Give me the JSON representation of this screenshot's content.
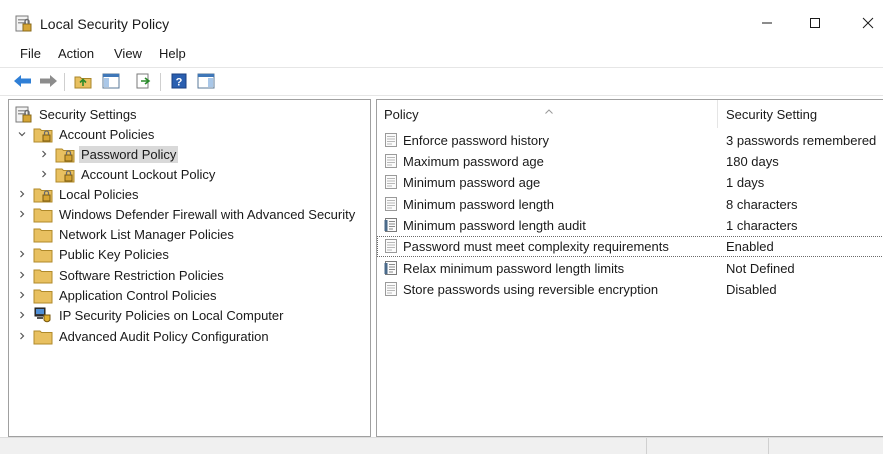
{
  "window": {
    "title": "Local Security Policy",
    "icon": "security-policy-icon",
    "controls": [
      "minimize-icon",
      "maximize-icon",
      "close-icon"
    ]
  },
  "menu": {
    "items": [
      "File",
      "Action",
      "View",
      "Help"
    ]
  },
  "toolbar": {
    "buttons": [
      "back-arrow-icon",
      "forward-arrow-icon",
      "up-folder-icon",
      "show-hide-console-tree-icon",
      "export-list-icon",
      "help-icon",
      "show-action-pane-icon"
    ]
  },
  "tree": {
    "root": "Security Settings",
    "items": [
      {
        "label": "Account Policies",
        "level": 1,
        "expanded": true
      },
      {
        "label": "Password Policy",
        "level": 2,
        "selected": true
      },
      {
        "label": "Account Lockout Policy",
        "level": 2
      },
      {
        "label": "Local Policies",
        "level": 1
      },
      {
        "label": "Windows Defender Firewall with Advanced Security",
        "level": 1
      },
      {
        "label": "Network List Manager Policies",
        "level": 1
      },
      {
        "label": "Public Key Policies",
        "level": 1
      },
      {
        "label": "Software Restriction Policies",
        "level": 1
      },
      {
        "label": "Application Control Policies",
        "level": 1
      },
      {
        "label": "IP Security Policies on Local Computer",
        "level": 1
      },
      {
        "label": "Advanced Audit Policy Configuration",
        "level": 1
      }
    ]
  },
  "list": {
    "columns": [
      "Policy",
      "Security Setting"
    ],
    "rows": [
      {
        "policy": "Enforce password history",
        "setting": "3 passwords remembered"
      },
      {
        "policy": "Maximum password age",
        "setting": "180 days"
      },
      {
        "policy": "Minimum password age",
        "setting": "1 days"
      },
      {
        "policy": "Minimum password length",
        "setting": "8 characters"
      },
      {
        "policy": "Minimum password length audit",
        "setting": "1 characters"
      },
      {
        "policy": "Password must meet complexity requirements",
        "setting": "Enabled"
      },
      {
        "policy": "Relax minimum password length limits",
        "setting": "Not Defined"
      },
      {
        "policy": "Store passwords using reversible encryption",
        "setting": "Disabled"
      }
    ]
  },
  "colors": {
    "selection": "#d9d9d9",
    "folder": "#e8c060",
    "pane_border": "#a0a0a0"
  }
}
